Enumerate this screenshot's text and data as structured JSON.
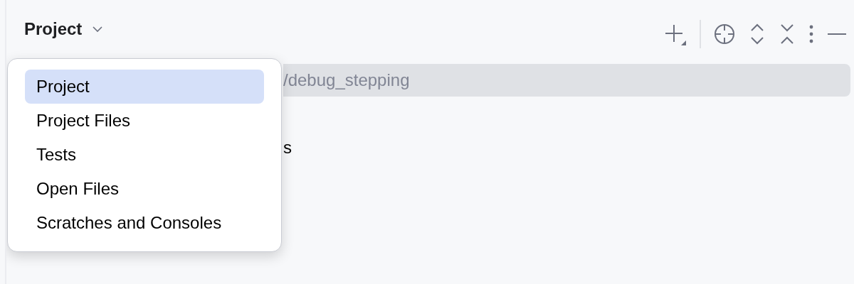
{
  "header": {
    "title": "Project"
  },
  "tree": {
    "rows": [
      {
        "text": "/debug_stepping",
        "selected": true
      },
      {
        "text": "s",
        "selected": false
      }
    ]
  },
  "popup": {
    "items": [
      {
        "label": "Project",
        "selected": true
      },
      {
        "label": "Project Files",
        "selected": false
      },
      {
        "label": "Tests",
        "selected": false
      },
      {
        "label": "Open Files",
        "selected": false
      },
      {
        "label": "Scratches and Consoles",
        "selected": false
      }
    ]
  }
}
